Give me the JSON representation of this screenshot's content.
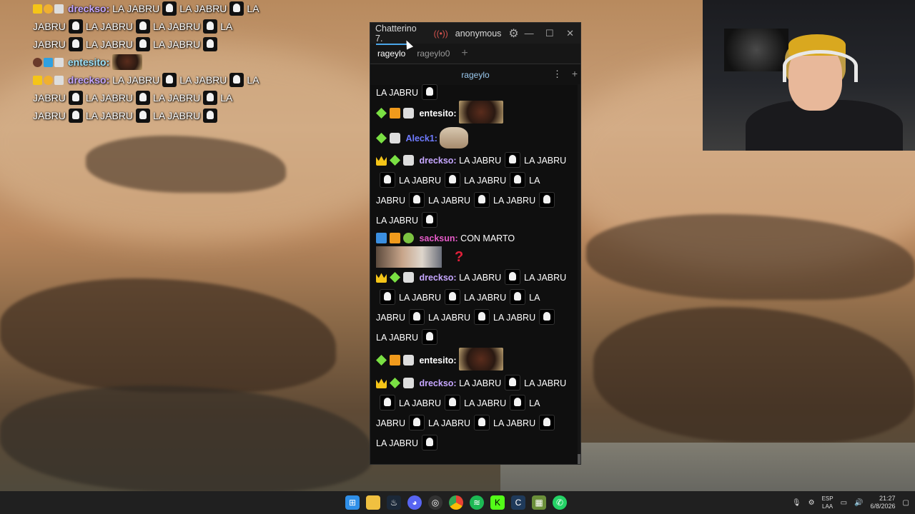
{
  "overlay": {
    "lines": [
      {
        "user": "drecksо"
      },
      {
        "user": "entesito"
      },
      {
        "user": "drecksо"
      }
    ],
    "user1": "drecksо:",
    "user2": "entesito:",
    "phrase": "LA JABRU",
    "la": "LA",
    "jabru": "JABRU"
  },
  "window": {
    "title": "Chatterino 7.",
    "account": "anonymous",
    "tabs": [
      "rageylo",
      "rageylo0"
    ],
    "add_tab": "+",
    "split_title": "rageylo",
    "split_menu": "⋮",
    "split_add": "+",
    "minimize": "—",
    "maximize": "☐",
    "close": "✕"
  },
  "chat": {
    "top_text": "LA JABRU",
    "entesito": "entesito:",
    "aleck": "Aleck1:",
    "drecksо": "drecksо:",
    "sacksun": "sacksun:",
    "sacksun_msg": "CON MARTO",
    "jabru": "LA JABRU",
    "la": "LA",
    "jabru_word": "JABRU",
    "qmark": "?"
  },
  "colors": {
    "drecksо": "#c6a7ff",
    "entesito": "#ffffff",
    "aleck": "#3b7bff",
    "sacksun": "#e65bc8",
    "accent": "#4aa6e9"
  },
  "taskbar": {
    "lang_top": "ESP",
    "lang_bottom": "LAA",
    "time": "21:27",
    "date": "6/8/2026",
    "apps": [
      "windows-start",
      "file-explorer",
      "steam",
      "discord",
      "obs",
      "chrome",
      "spotify",
      "kick",
      "chatterino",
      "minecraft",
      "whatsapp"
    ]
  }
}
